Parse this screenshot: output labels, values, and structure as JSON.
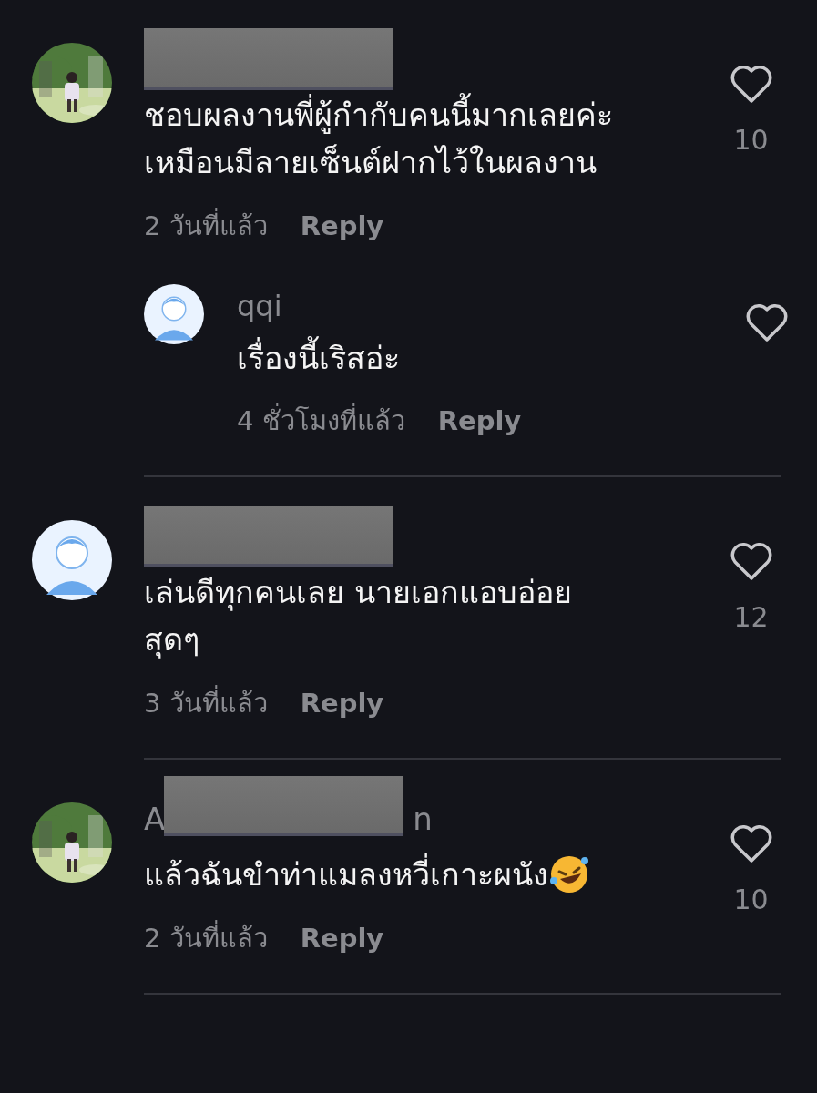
{
  "comments": [
    {
      "avatar": {
        "kind": "picture"
      },
      "name_redacted": true,
      "text": [
        "ชอบผลงานพี่ผู้กำกับคนนี้มากเลยค่ะ",
        "เหมือนมีลายเซ็นต์ฝากไว้ในผลงาน"
      ],
      "time": "2 วันที่แล้ว",
      "reply": "Reply",
      "likes": "10",
      "liked": false,
      "replies": [
        {
          "avatar": {
            "kind": "silhouette"
          },
          "name": "qqi",
          "text": "เรื่องนี้เริสอ่ะ",
          "time": "4 ชั่วโมงที่แล้ว",
          "reply": "Reply",
          "liked": false
        }
      ]
    },
    {
      "avatar": {
        "kind": "silhouette"
      },
      "name_redacted": true,
      "text": [
        "เล่นดีทุกคนเลย นายเอกแอบอ่อย",
        "สุดๆ"
      ],
      "time": "3 วันที่แล้ว",
      "reply": "Reply",
      "likes": "12",
      "liked": false
    },
    {
      "avatar": {
        "kind": "picture"
      },
      "name_redacted": true,
      "name_parts": [
        "A",
        "n"
      ],
      "text": [
        "แล้วฉันขำท่าแมลงหวี่เกาะผนัง"
      ],
      "trailing_emoji": true,
      "time": "2 วันที่แล้ว",
      "reply": "Reply",
      "likes": "10",
      "liked": false
    }
  ]
}
